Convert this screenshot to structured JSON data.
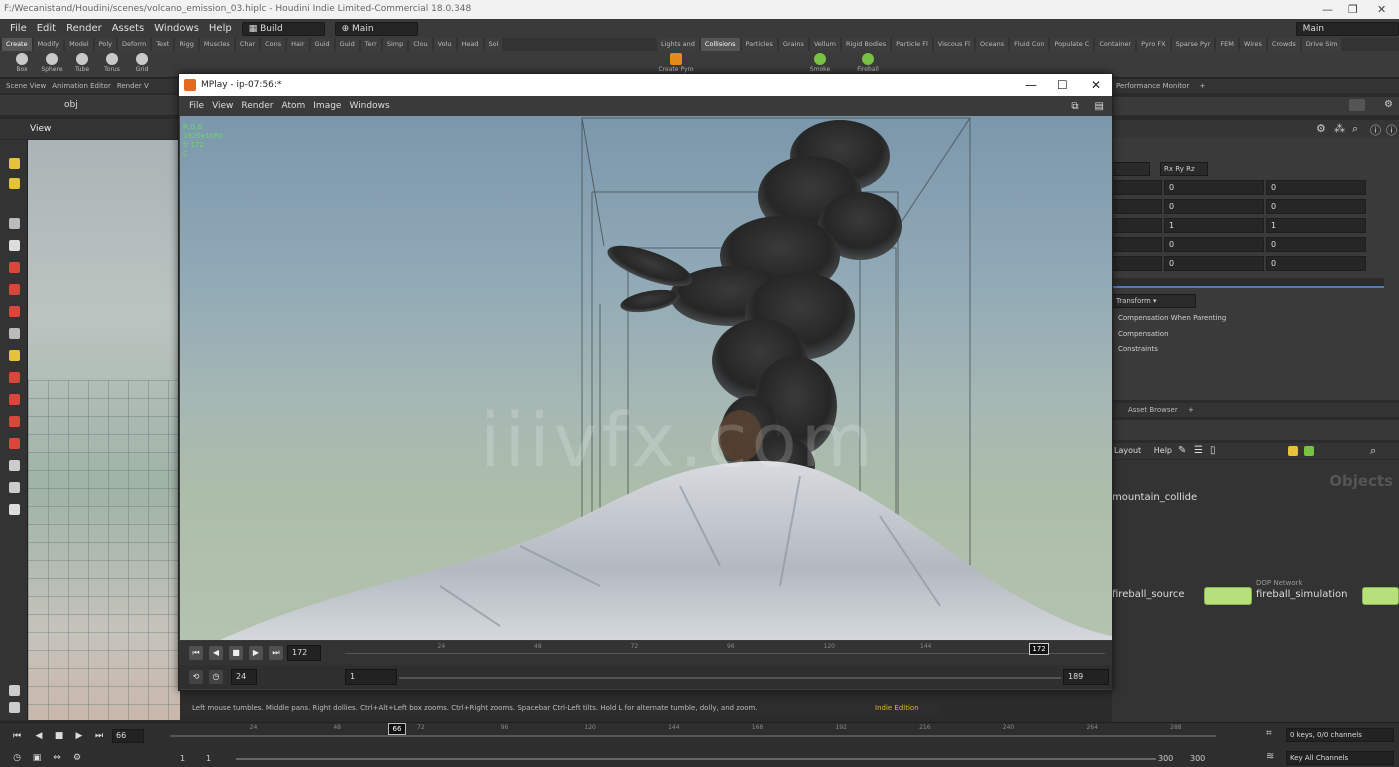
{
  "app": {
    "title": "F:/Wecanistand/Houdini/scenes/volcano_emission_03.hiplc - Houdini Indie Limited-Commercial 18.0.348"
  },
  "menu": {
    "items": [
      "File",
      "Edit",
      "Render",
      "Assets",
      "Windows",
      "Help"
    ],
    "desktop_select": "Build",
    "network_select": "Main"
  },
  "shelf_tabs_left": [
    "Create",
    "Modify",
    "Model",
    "Poly",
    "Deform",
    "Text",
    "Rigg",
    "Muscles",
    "Char",
    "Cons",
    "Hair",
    "Guid",
    "Guid",
    "Terr",
    "Simp",
    "Clou",
    "Volu",
    "Head",
    "Sol"
  ],
  "shelf_tabs_right": [
    "Lights and",
    "Collisions",
    "Particles",
    "Grains",
    "Vellum",
    "Rigid Bodies",
    "Particle Fl",
    "Viscous Fl",
    "Oceans",
    "Fluid Con",
    "Populate C",
    "Container",
    "Pyro FX",
    "Sparse Pyr",
    "FEM",
    "Wires",
    "Crowds",
    "Drive Sim"
  ],
  "shelf_tools_left": [
    "Box",
    "Sphere",
    "Tube",
    "Torus",
    "Grid"
  ],
  "shelf_tools_right": [
    "Create Pyro",
    "Smoke",
    "Fireball"
  ],
  "scene_pane": {
    "tabs": [
      "Scene View",
      "Animation Editor",
      "Render V"
    ],
    "path": "obj",
    "view_label": "View"
  },
  "right_pane": {
    "network_select": "Main",
    "tab": "Performance Monitor",
    "rotate_order": "Rx Ry Rz",
    "rows": [
      {
        "a": "0",
        "b": "0"
      },
      {
        "a": "0",
        "b": "0"
      },
      {
        "a": "1",
        "b": "1"
      },
      {
        "a": "0",
        "b": "0"
      },
      {
        "a": "0",
        "b": "0"
      }
    ],
    "transform_select": "Transform",
    "options": [
      "Compensation When Parenting",
      "Compensation",
      "Constraints"
    ]
  },
  "network_pane": {
    "tab": "Asset Browser",
    "menu": [
      "Layout",
      "Help"
    ],
    "context": "Objects",
    "nodes": [
      {
        "label": "mountain_collide"
      },
      {
        "label": "fireball_source"
      },
      {
        "label": "fireball_simulation",
        "type": "DOP Network"
      }
    ]
  },
  "mplay": {
    "title": "MPlay - ip-07:56:*",
    "menu": [
      "File",
      "View",
      "Render",
      "Atom",
      "Image",
      "Windows"
    ],
    "overlay": [
      "R,G,B",
      "1920x1080",
      "fr 172",
      "C"
    ],
    "watermark": "iiivfx.com",
    "current_frame": "172",
    "frame_marker": "172",
    "fps": "24",
    "range_start": "1",
    "range_end": "189",
    "ticks": [
      "24",
      "48",
      "72",
      "96",
      "120",
      "144"
    ]
  },
  "status": {
    "message": "Left mouse tumbles. Middle pans. Right dollies. Ctrl+Alt+Left box zooms. Ctrl+Right zooms. Spacebar Ctrl-Left tilts. Hold L for alternate tumble, dolly, and zoom.",
    "edition": "Indie Edition"
  },
  "timeline": {
    "current_frame": "66",
    "marker": "66",
    "start": "1",
    "start2": "1",
    "end": "300",
    "end2": "300",
    "ticks": [
      "24",
      "48",
      "72",
      "96",
      "120",
      "144",
      "168",
      "192",
      "216",
      "240",
      "264",
      "288"
    ],
    "keys_label": "0 keys, 0/0 channels",
    "key_all": "Key All Channels"
  },
  "colors": {
    "houdini_orange": "#e46a1e",
    "node_green": "#b6e07a",
    "overlay_green": "#6fd76f",
    "indie_yellow": "#e2b23a"
  }
}
